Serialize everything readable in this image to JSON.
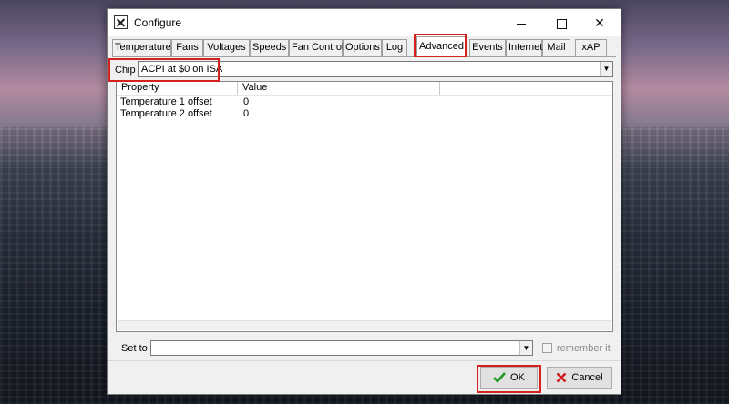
{
  "window": {
    "title": "Configure",
    "controls": [
      "minimize",
      "maximize",
      "close"
    ]
  },
  "tabs": [
    {
      "label": "Temperatures"
    },
    {
      "label": "Fans"
    },
    {
      "label": "Voltages"
    },
    {
      "label": "Speeds"
    },
    {
      "label": "Fan Control"
    },
    {
      "label": "Options"
    },
    {
      "label": "Log"
    },
    {
      "label": "Advanced",
      "active": true
    },
    {
      "label": "Events"
    },
    {
      "label": "Internet"
    },
    {
      "label": "Mail"
    },
    {
      "label": "xAP"
    }
  ],
  "chip": {
    "label": "Chip",
    "value": "ACPI at $0 on ISA"
  },
  "table": {
    "columns": [
      "Property",
      "Value"
    ],
    "rows": [
      {
        "property": "Temperature 1 offset",
        "value": "0"
      },
      {
        "property": "Temperature 2 offset",
        "value": "0"
      }
    ]
  },
  "set_to": {
    "label": "Set to",
    "value": "",
    "remember_label": "remember it",
    "remember_checked": false
  },
  "buttons": {
    "ok": "OK",
    "cancel": "Cancel"
  },
  "colors": {
    "highlight": "#d62020",
    "ok_check": "#1f9a1f",
    "cancel_x": "#d01c1c"
  }
}
